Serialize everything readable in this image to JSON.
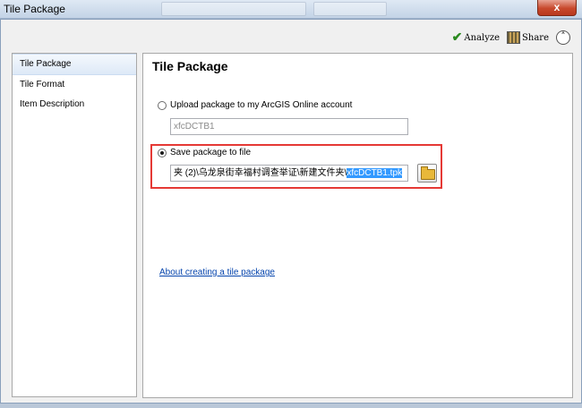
{
  "window": {
    "title": "Tile Package",
    "close_label": "x"
  },
  "toolbar": {
    "analyze_label": "Analyze",
    "share_label": "Share",
    "collapse_label": "˄"
  },
  "sidebar": {
    "items": [
      {
        "label": "Tile Package",
        "active": true
      },
      {
        "label": "Tile Format",
        "active": false
      },
      {
        "label": "Item Description",
        "active": false
      }
    ]
  },
  "main": {
    "title": "Tile Package",
    "upload_option": {
      "label": "Upload package to my ArcGIS Online account",
      "selected": false,
      "value": "xfcDCTB1"
    },
    "save_option": {
      "label": "Save package to file",
      "selected": true,
      "path_prefix": "夹 (2)\\乌龙泉街幸福村调查举证\\新建文件夹\\",
      "path_selected": "xfcDCTB1.tpk"
    },
    "link_text": "About creating a tile package"
  },
  "colors": {
    "highlight": "#e53935",
    "selection": "#3399ff",
    "link": "#0645ad"
  }
}
